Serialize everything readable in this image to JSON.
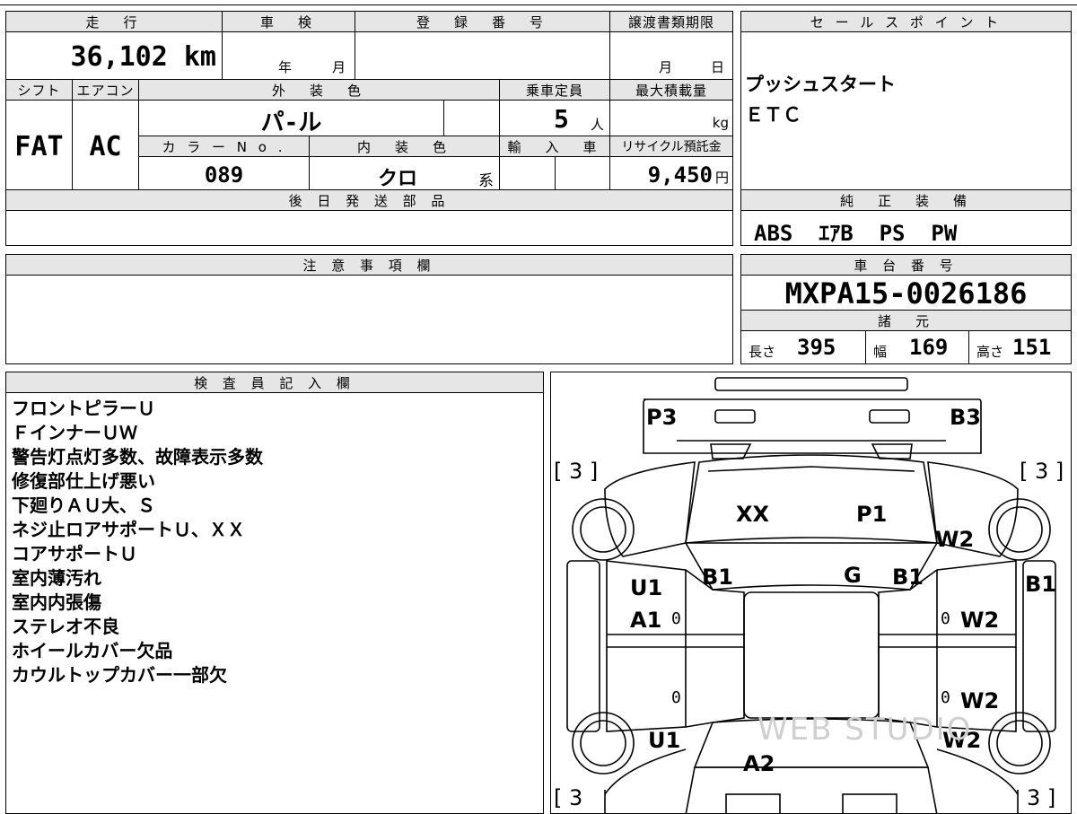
{
  "headers": {
    "mileage": "走　行",
    "inspection": "車　検",
    "registration": "登　録　番　号",
    "transfer_deadline": "譲渡書類期限",
    "sales_point": "セ ー ル ス ポ イ ン ト",
    "shift": "シフト",
    "aircon": "エアコン",
    "exterior_color": "外　装　色",
    "capacity": "乗車定員",
    "max_load": "最大積載量",
    "color_no": "カ ラ ー N o .",
    "interior_color": "内　装　色",
    "import": "輸　入　車",
    "recycle": "リサイクル預託金",
    "later_parts": "後 日 発 送 部 品",
    "genuine_equipment": "純　正　装　備",
    "caution": "注 意 事 項 欄",
    "chassis_no": "車 台 番 号",
    "specs": "諸　元",
    "inspector": "検 査 員 記 入 欄"
  },
  "values": {
    "mileage": "36,102 km",
    "inspection_year": "年",
    "inspection_month": "月",
    "deadline_month": "月",
    "deadline_day": "日",
    "shift": "FAT",
    "aircon": "AC",
    "exterior_color": "パ-ル",
    "capacity": "5",
    "capacity_unit": "人",
    "load_unit": "kg",
    "color_no": "089",
    "interior_color": "クロ",
    "interior_suffix": "系",
    "recycle": "9,450",
    "recycle_unit": "円",
    "equipment": "ABS  ｴｱB  PS  PW",
    "chassis_no": "MXPA15-0026186",
    "length_label": "長さ",
    "length": "395",
    "width_label": "幅",
    "width": "169",
    "height_label": "高さ",
    "height": "151"
  },
  "sales_points": [
    "プッシュスタート",
    "ＥＴＣ"
  ],
  "inspector_notes": [
    "フロントピラーＵ",
    "ＦインナーＵＷ",
    "警告灯点灯多数、故障表示多数",
    "修復部仕上げ悪い",
    "下廻りＡＵ大、Ｓ",
    "ネジ止ロアサポートＵ、ＸＸ",
    "コアサポートＵ",
    "室内薄汚れ",
    "室内内張傷",
    "ステレオ不良",
    "ホイールカバー欠品",
    "カウルトップカバー一部欠"
  ],
  "diagram": {
    "tire_fl": "[ 3 ]",
    "tire_fr": "[ 3 ]",
    "tire_rl": "[ 3",
    "tire_rr": "3 ]",
    "p3": "P3",
    "b3": "B3",
    "xx": "XX",
    "p1": "P1",
    "w2_fender": "W2",
    "b1_left": "B1",
    "g": "G",
    "b1_center": "B1",
    "b1_right": "B1",
    "u1_front": "U1",
    "a1": "A1",
    "zero1": "0",
    "zero2": "0",
    "zero3": "0",
    "zero4": "0",
    "w2_fdoor": "W2",
    "w2_rdoor": "W2",
    "u1_rear": "U1",
    "w2_rear": "W2",
    "a2": "A2",
    "watermark": "WEB STUDIO"
  }
}
